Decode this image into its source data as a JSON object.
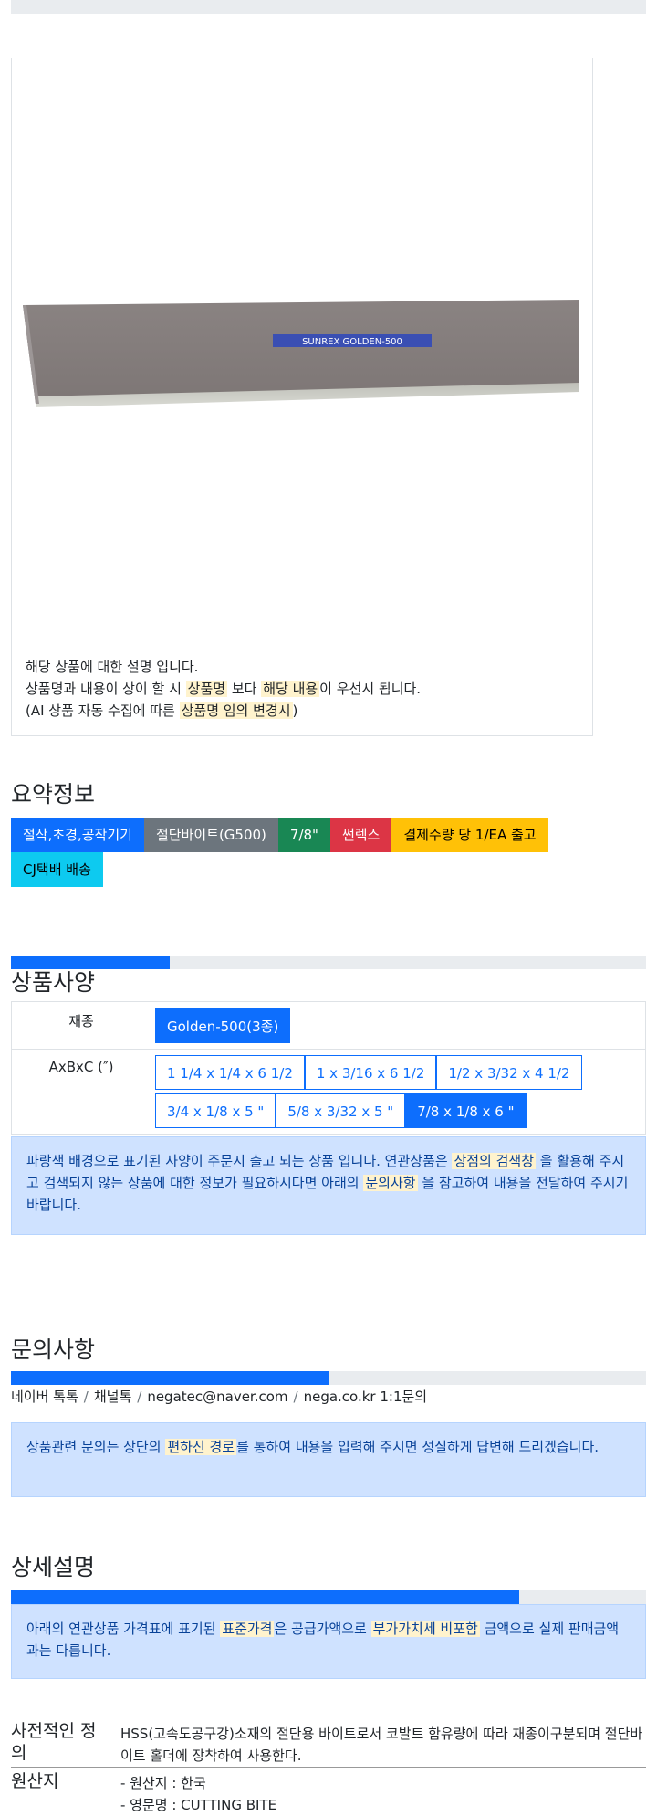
{
  "product_image": {
    "blade_text": "SUNREX GOLDEN-500",
    "description_lines": {
      "line1": "해당 상품에 대한 설명 입니다.",
      "line2_a": "상품명과 내용이 상이 할 시 ",
      "line2_hl1": "상품명",
      "line2_b": " 보다 ",
      "line2_hl2": "해당 내용",
      "line2_c": "이 우선시 됩니다.",
      "line3_a": "(AI 상품 자동 수집에 따른 ",
      "line3_hl": "상품명 임의 변경시",
      "line3_b": ")"
    }
  },
  "summary": {
    "title": "요약정보",
    "badges": [
      {
        "label": "절삭,초경,공작기기",
        "color": "#0d6efd",
        "text_color": "#ffffff"
      },
      {
        "label": "절단바이트(G500)",
        "color": "#6c757d",
        "text_color": "#ffffff"
      },
      {
        "label": "7/8\"",
        "color": "#198754",
        "text_color": "#ffffff"
      },
      {
        "label": "썬렉스",
        "color": "#dc3545",
        "text_color": "#ffffff"
      },
      {
        "label": "결제수량 당 1/EA 출고",
        "color": "#ffc107",
        "text_color": "#000000"
      },
      {
        "label": "CJ택배 배송",
        "color": "#0dcaf0",
        "text_color": "#000000"
      }
    ]
  },
  "spec": {
    "progress": 0.25,
    "title": "상품사양",
    "row1_label": "재종",
    "row1_options": [
      "Golden-500(3종)"
    ],
    "row2_label": "AxBxC (″)",
    "row2_options": [
      "1 1/4 x 1/4 x 6 1/2",
      "1 x 3/16 x 6 1/2",
      "1/2 x 3/32 x 4 1/2",
      "3/4 x 1/8 x 5 \"",
      "5/8 x 3/32 x 5 \"",
      "7/8 x 1/8 x 6 \""
    ],
    "row2_selected": 5,
    "notice_a": "파랑색 배경으로 표기된 사양이 주문시 출고 되는 상품 입니다. 연관상품은 ",
    "notice_hl1": "상점의 검색창",
    "notice_b": " 을 활용해 주시고 검색되지 않는 상품에 대한 정보가 필요하시다면 아래의 ",
    "notice_hl2": "문의사항",
    "notice_c": " 을 참고하여 내용을 전달하여 주시기 바랍니다."
  },
  "inquiry": {
    "title": "문의사항",
    "progress": 0.5,
    "contacts": [
      "네이버 톡톡",
      "채널톡",
      "negatec@naver.com",
      "nega.co.kr 1:1문의"
    ],
    "separator": "/",
    "notice_a": "상품관련 문의는 상단의 ",
    "notice_hl": "편하신 경로",
    "notice_b": "를 통하여 내용을 입력해 주시면 성실하게 답변해 드리겠습니다."
  },
  "detail": {
    "title": "상세설명",
    "progress": 0.8,
    "notice_a": "아래의 연관상품 가격표에 표기된 ",
    "notice_hl1": "표준가격",
    "notice_b": "은 공급가액으로 ",
    "notice_hl2": "부가가치세 비포함",
    "notice_c": " 금액으로 실제 판매금액과는 다릅니다.",
    "definition_label": "사전적인 정의",
    "definition_text": "HSS(고속도공구강)소재의 절단용 바이트로서 코발트 함유량에 따라 재종이구분되며 절단바이트 홀더에 장착하여 사용한다.",
    "origin_label": "원산지",
    "origin_lines": [
      "- 원산지 : 한국",
      "- 영문명 : CUTTING BITE"
    ]
  }
}
